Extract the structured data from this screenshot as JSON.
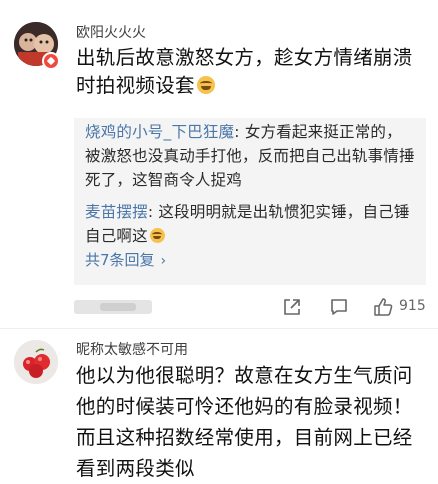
{
  "comment1": {
    "username": "欧阳火火火",
    "text": "出轨后故意激怒女方，趁女方情绪崩溃时拍视频设套",
    "replies": [
      {
        "author": "烧鸡的小号_下巴狂魔",
        "text": "女方看起来挺正常的，被激怒也没真动手打他，反而把自己出轨事情捶死了，这智商令人捉鸡"
      },
      {
        "author": "麦苗摆摆",
        "text": "这段明明就是出轨惯犯实锤，自己锤自己啊这"
      }
    ],
    "more_replies": "共7条回复",
    "more_chevron": "›",
    "like_count": "915"
  },
  "comment2": {
    "username": "昵称太敏感不可用",
    "text": "他以为他很聪明？故意在女方生气质问他的时候装可怜还他妈的有脸录视频！而且这种招数经常使用，目前网上已经看到两段类似"
  },
  "icons": {
    "share": "share-icon",
    "reply": "comment-icon",
    "like": "thumbs-up-icon",
    "emoji": "laugh-cry-emoji-icon",
    "verified": "verified-badge-icon"
  },
  "colors": {
    "link": "#4a76a8",
    "reply_bg": "#f4f4f4",
    "badge": "#f04a3f"
  }
}
